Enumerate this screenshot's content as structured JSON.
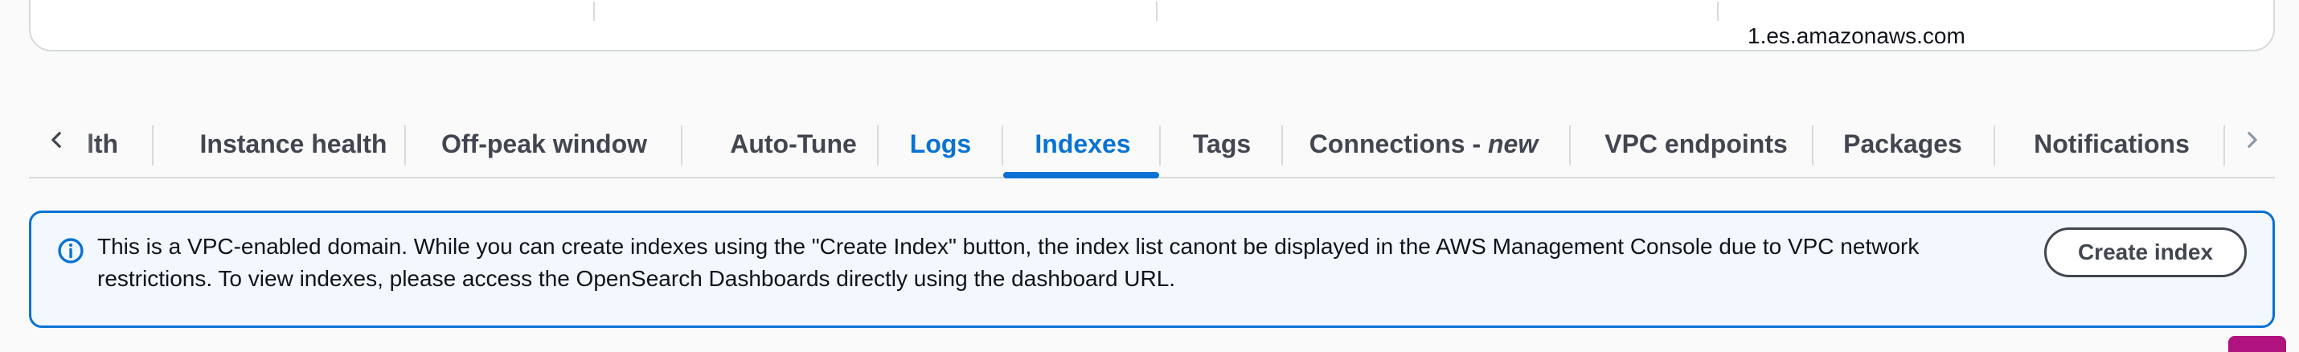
{
  "top_section": {
    "endpoint_value_partial": "1.es.amazonaws.com"
  },
  "tabs": {
    "items": [
      {
        "label": "lth",
        "state": "partial"
      },
      {
        "label": "Instance health",
        "state": "normal"
      },
      {
        "label": "Off-peak window",
        "state": "normal"
      },
      {
        "label": "Auto-Tune",
        "state": "normal"
      },
      {
        "label": "Logs",
        "state": "link"
      },
      {
        "label": "Indexes",
        "state": "active"
      },
      {
        "label": "Tags",
        "state": "normal"
      },
      {
        "label": "Connections - ",
        "suffix_italic": "new",
        "state": "normal"
      },
      {
        "label": "VPC endpoints",
        "state": "normal"
      },
      {
        "label": "Packages",
        "state": "normal"
      },
      {
        "label": "Notifications",
        "state": "normal"
      }
    ],
    "scroll_left_icon": "chevron-left-icon",
    "scroll_right_icon": "chevron-right-icon"
  },
  "alert": {
    "type": "info",
    "icon": "info-icon",
    "line1": "This is a VPC-enabled domain. While you can create indexes using the \"Create Index\" button, the index list canont be displayed in the AWS Management Console due to VPC network",
    "line2": "restrictions. To view indexes, please access the OpenSearch Dashboards directly using the dashboard URL.",
    "action_label": "Create index"
  },
  "colors": {
    "accent": "#0972d3",
    "alert_bg": "#f2f8fd",
    "text": "#0f141a",
    "tab_text": "#424650",
    "divider": "#d5dbdb"
  }
}
